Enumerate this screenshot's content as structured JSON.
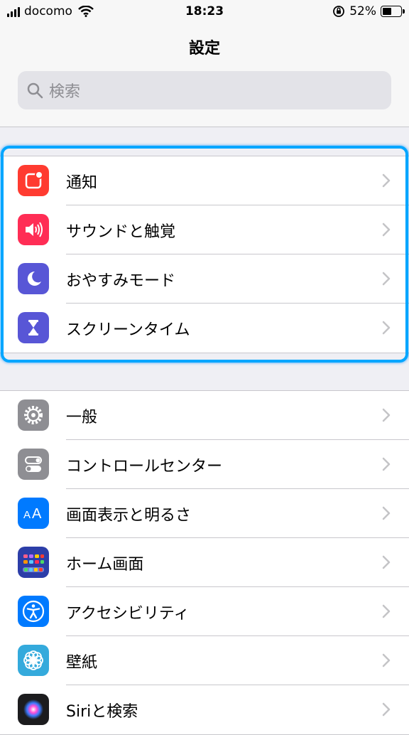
{
  "status_bar": {
    "carrier": "docomo",
    "time": "18:23",
    "battery": "52%",
    "battery_level": 0.52
  },
  "header": {
    "title": "設定"
  },
  "search": {
    "placeholder": "検索"
  },
  "group1": [
    {
      "label": "通知",
      "icon": "notifications-icon",
      "color": "#ff3b30"
    },
    {
      "label": "サウンドと触覚",
      "icon": "sound-icon",
      "color": "#ff2d55"
    },
    {
      "label": "おやすみモード",
      "icon": "moon-icon",
      "color": "#5856d6"
    },
    {
      "label": "スクリーンタイム",
      "icon": "hourglass-icon",
      "color": "#5856d6"
    }
  ],
  "group2": [
    {
      "label": "一般",
      "icon": "gear-icon",
      "color": "#8e8e93"
    },
    {
      "label": "コントロールセンター",
      "icon": "toggles-icon",
      "color": "#8e8e93"
    },
    {
      "label": "画面表示と明るさ",
      "icon": "text-size-icon",
      "color": "#007aff"
    },
    {
      "label": "ホーム画面",
      "icon": "home-screen-icon",
      "color": "#2c3ea8"
    },
    {
      "label": "アクセシビリティ",
      "icon": "accessibility-icon",
      "color": "#007aff"
    },
    {
      "label": "壁紙",
      "icon": "wallpaper-icon",
      "color": "#34aadc"
    },
    {
      "label": "Siriと検索",
      "icon": "siri-icon",
      "color": "#1c1c1e"
    }
  ]
}
